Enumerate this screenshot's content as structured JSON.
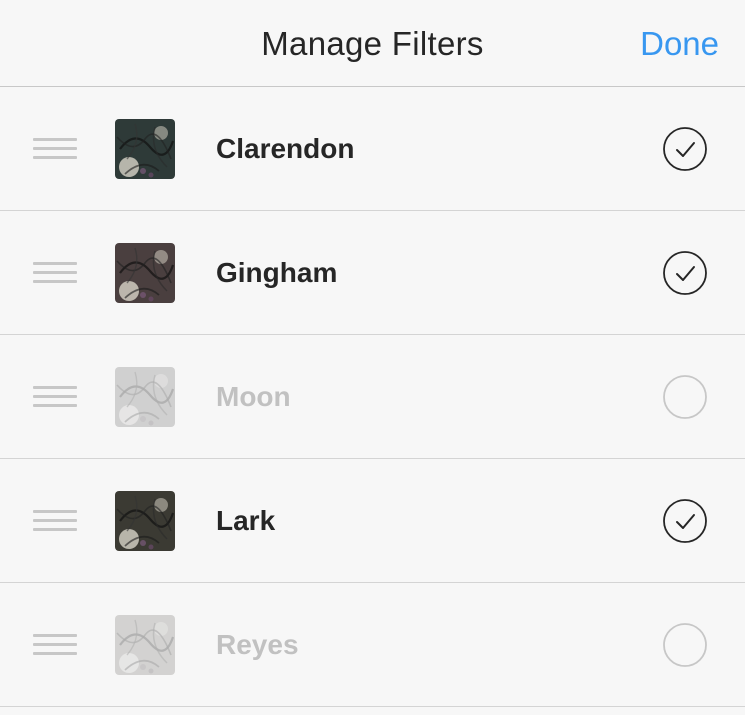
{
  "header": {
    "title": "Manage Filters",
    "done_label": "Done"
  },
  "filters": [
    {
      "name": "Clarendon",
      "enabled": true,
      "tint": "#2e3a38"
    },
    {
      "name": "Gingham",
      "enabled": true,
      "tint": "#4a3f3f"
    },
    {
      "name": "Moon",
      "enabled": false,
      "tint": "#8a8a8a"
    },
    {
      "name": "Lark",
      "enabled": true,
      "tint": "#3b3a33"
    },
    {
      "name": "Reyes",
      "enabled": false,
      "tint": "#9a8f80"
    }
  ],
  "colors": {
    "accent": "#3897f0",
    "text": "#262626",
    "disabled_text": "#c1c1c1"
  }
}
